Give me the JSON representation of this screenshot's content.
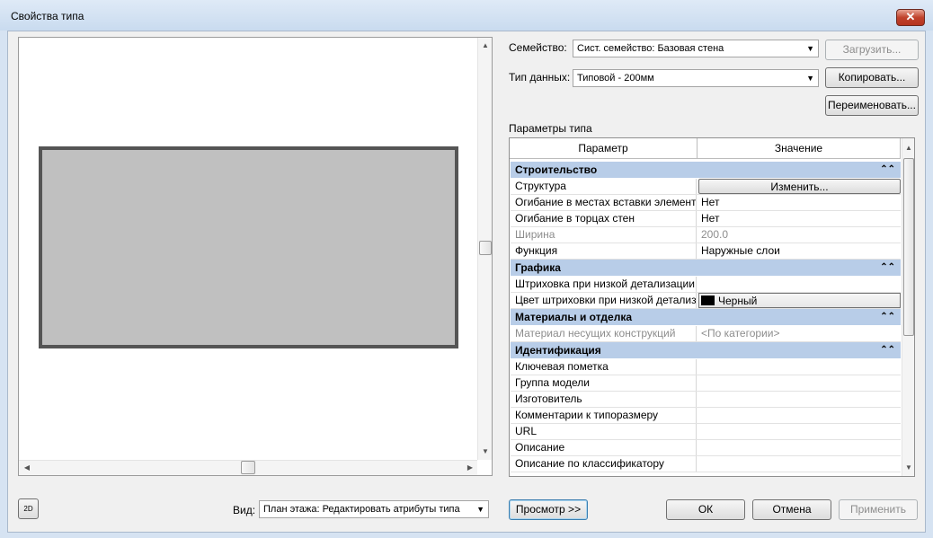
{
  "window": {
    "title": "Свойства типа",
    "close_glyph": "✕"
  },
  "family": {
    "label": "Семейство:",
    "value": "Сист. семейство: Базовая стена",
    "load_button": "Загрузить..."
  },
  "type": {
    "label": "Тип данных:",
    "value": "Типовой - 200мм",
    "duplicate_button": "Копировать...",
    "rename_button": "Переименовать..."
  },
  "params": {
    "section_label": "Параметры типа",
    "col_param": "Параметр",
    "col_value": "Значение",
    "groups": [
      {
        "name": "Строительство",
        "rows": [
          {
            "param": "Структура",
            "value": "Изменить...",
            "kind": "button"
          },
          {
            "param": "Огибание в местах вставки элемент",
            "value": "Нет"
          },
          {
            "param": "Огибание в торцах стен",
            "value": "Нет"
          },
          {
            "param": "Ширина",
            "value": "200.0",
            "kind": "gray"
          },
          {
            "param": "Функция",
            "value": "Наружные слои"
          }
        ]
      },
      {
        "name": "Графика",
        "rows": [
          {
            "param": "Штриховка при низкой детализации",
            "value": ""
          },
          {
            "param": "Цвет штриховки при низкой детализ",
            "value": "Черный",
            "kind": "color",
            "swatch": "#000000"
          }
        ]
      },
      {
        "name": "Материалы и отделка",
        "rows": [
          {
            "param": "Материал несущих конструкций",
            "value": "<По категории>",
            "kind": "gray"
          }
        ]
      },
      {
        "name": "Идентификация",
        "rows": [
          {
            "param": "Ключевая пометка",
            "value": ""
          },
          {
            "param": "Группа модели",
            "value": ""
          },
          {
            "param": "Изготовитель",
            "value": ""
          },
          {
            "param": "Комментарии к типоразмеру",
            "value": ""
          },
          {
            "param": "URL",
            "value": ""
          },
          {
            "param": "Описание",
            "value": ""
          },
          {
            "param": "Описание по классификатору",
            "value": ""
          }
        ]
      }
    ]
  },
  "bottom": {
    "view_label": "Вид:",
    "view_value": "План этажа: Редактировать атрибуты типа",
    "preview_button": "Просмотр >>",
    "ok_button": "ОК",
    "cancel_button": "Отмена",
    "apply_button": "Применить",
    "view_toggle_icon_text": "2D"
  },
  "icons": {
    "collapse": "⌃⌃",
    "dropdown": "▼",
    "scroll_up": "▲",
    "scroll_down": "▼",
    "scroll_left": "◀",
    "scroll_right": "▶"
  },
  "colors": {
    "group_header": "#b8cde8",
    "preview_wall": "#c0c0c0"
  }
}
